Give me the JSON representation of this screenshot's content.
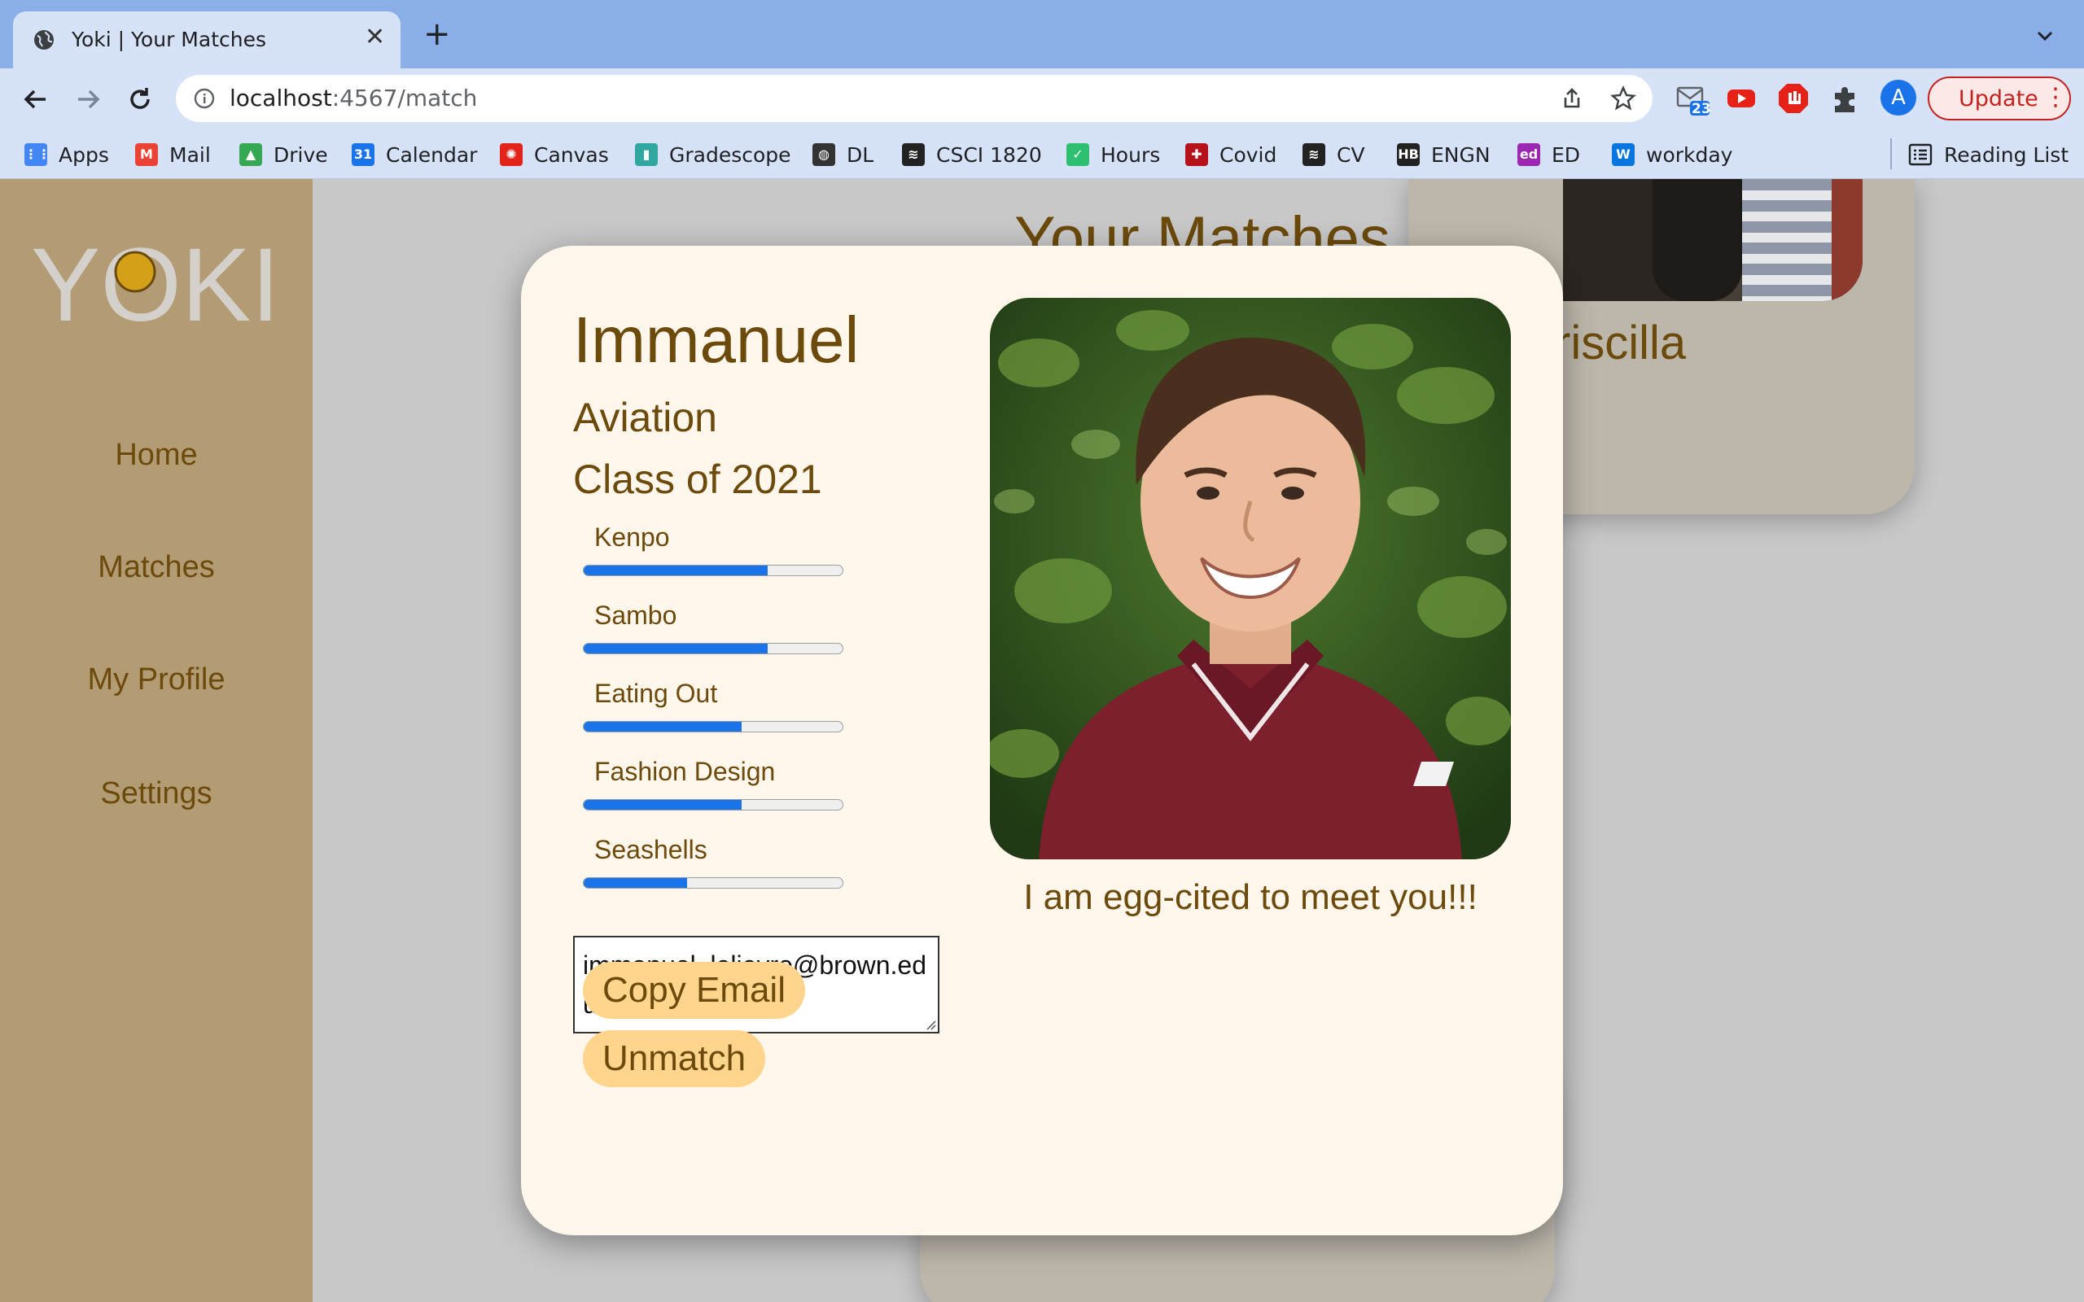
{
  "browser": {
    "tab_title": "Yoki | Your Matches",
    "url_host": "localhost",
    "url_rest": ":4567/match",
    "update_label": "Update",
    "avatar_letter": "A",
    "mail_badge": "23",
    "bookmarks": [
      {
        "label": "Apps",
        "icon": "apps-grid-icon",
        "color": "#4285f4"
      },
      {
        "label": "Mail",
        "icon": "gmail-icon",
        "color": "#ea4335"
      },
      {
        "label": "Drive",
        "icon": "drive-icon",
        "color": "#34a853"
      },
      {
        "label": "Calendar",
        "icon": "calendar-icon",
        "color": "#1a73e8"
      },
      {
        "label": "Canvas",
        "icon": "canvas-icon",
        "color": "#e2231a"
      },
      {
        "label": "Gradescope",
        "icon": "gradescope-icon",
        "color": "#30a8a0"
      },
      {
        "label": "DL",
        "icon": "globe-icon",
        "color": "#333333"
      },
      {
        "label": "CSCI 1820",
        "icon": "csci-icon",
        "color": "#222222"
      },
      {
        "label": "Hours",
        "icon": "hours-icon",
        "color": "#2fbf71"
      },
      {
        "label": "Covid",
        "icon": "covid-icon",
        "color": "#b5121b"
      },
      {
        "label": "CV",
        "icon": "cv-icon",
        "color": "#222222"
      },
      {
        "label": "ENGN",
        "icon": "engn-icon",
        "color": "#222222"
      },
      {
        "label": "ED",
        "icon": "ed-icon",
        "color": "#9c27b0"
      },
      {
        "label": "workday",
        "icon": "workday-icon",
        "color": "#0875e1"
      }
    ],
    "reading_list": "Reading List"
  },
  "sidebar": {
    "logo_text": "YOKI",
    "items": [
      "Home",
      "Matches",
      "My Profile",
      "Settings"
    ]
  },
  "background": {
    "title": "Your Matches",
    "card_name": "riscilla"
  },
  "modal": {
    "name": "Immanuel",
    "major": "Aviation",
    "class_year": "Class of 2021",
    "interests": [
      {
        "label": "Kenpo",
        "level": 0.71
      },
      {
        "label": "Sambo",
        "level": 0.71
      },
      {
        "label": "Eating Out",
        "level": 0.61
      },
      {
        "label": "Fashion Design",
        "level": 0.61
      },
      {
        "label": "Seashells",
        "level": 0.4
      }
    ],
    "email": "immanuel_lelievre@brown.edu",
    "copy_label": "Copy Email",
    "unmatch_label": "Unmatch",
    "tagline": "I am egg-cited to meet you!!!"
  },
  "colors": {
    "accent_brown": "#6b4a0c",
    "sidebar": "#b39b74",
    "modal_bg": "#fff7ec",
    "pill": "#ffd58e",
    "bar_fill": "#1a73e8"
  }
}
